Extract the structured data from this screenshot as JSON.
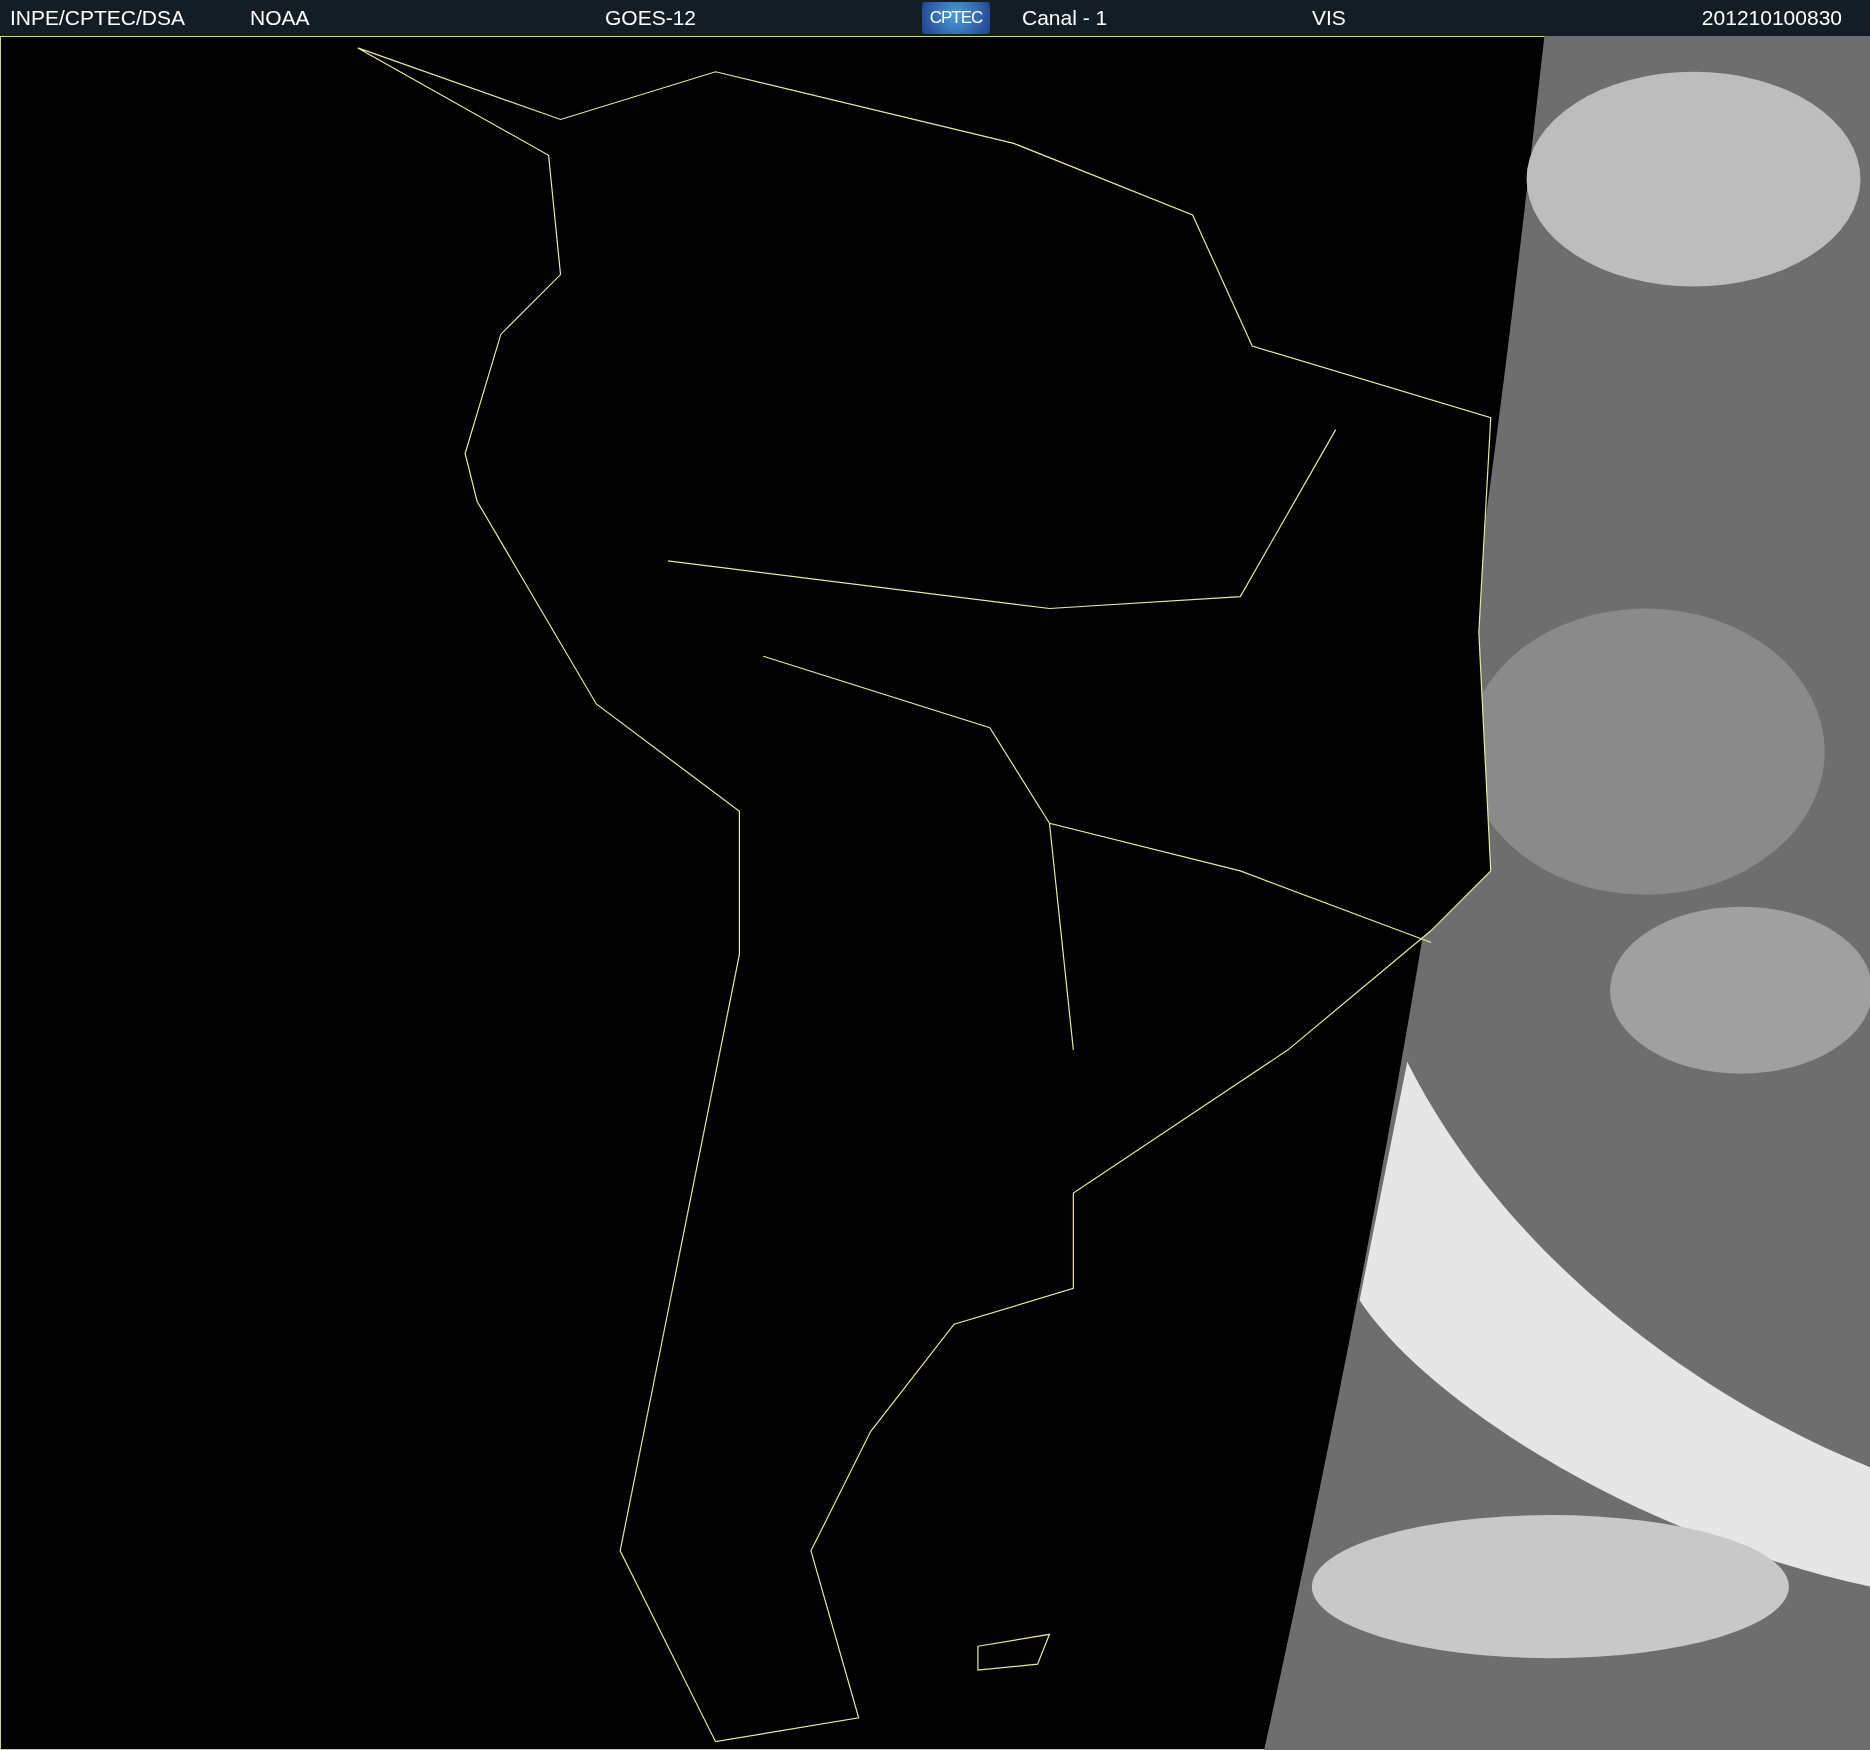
{
  "header": {
    "items": [
      {
        "kind": "text",
        "text": "INPE/CPTEC/DSA"
      },
      {
        "kind": "text",
        "text": "NOAA"
      },
      {
        "kind": "text",
        "text": "GOES-12"
      },
      {
        "kind": "logo",
        "text": "CPTEC"
      },
      {
        "kind": "text",
        "text": "Canal - 1"
      },
      {
        "kind": "text",
        "text": "VIS"
      },
      {
        "kind": "text",
        "text": "201210100830"
      }
    ]
  }
}
